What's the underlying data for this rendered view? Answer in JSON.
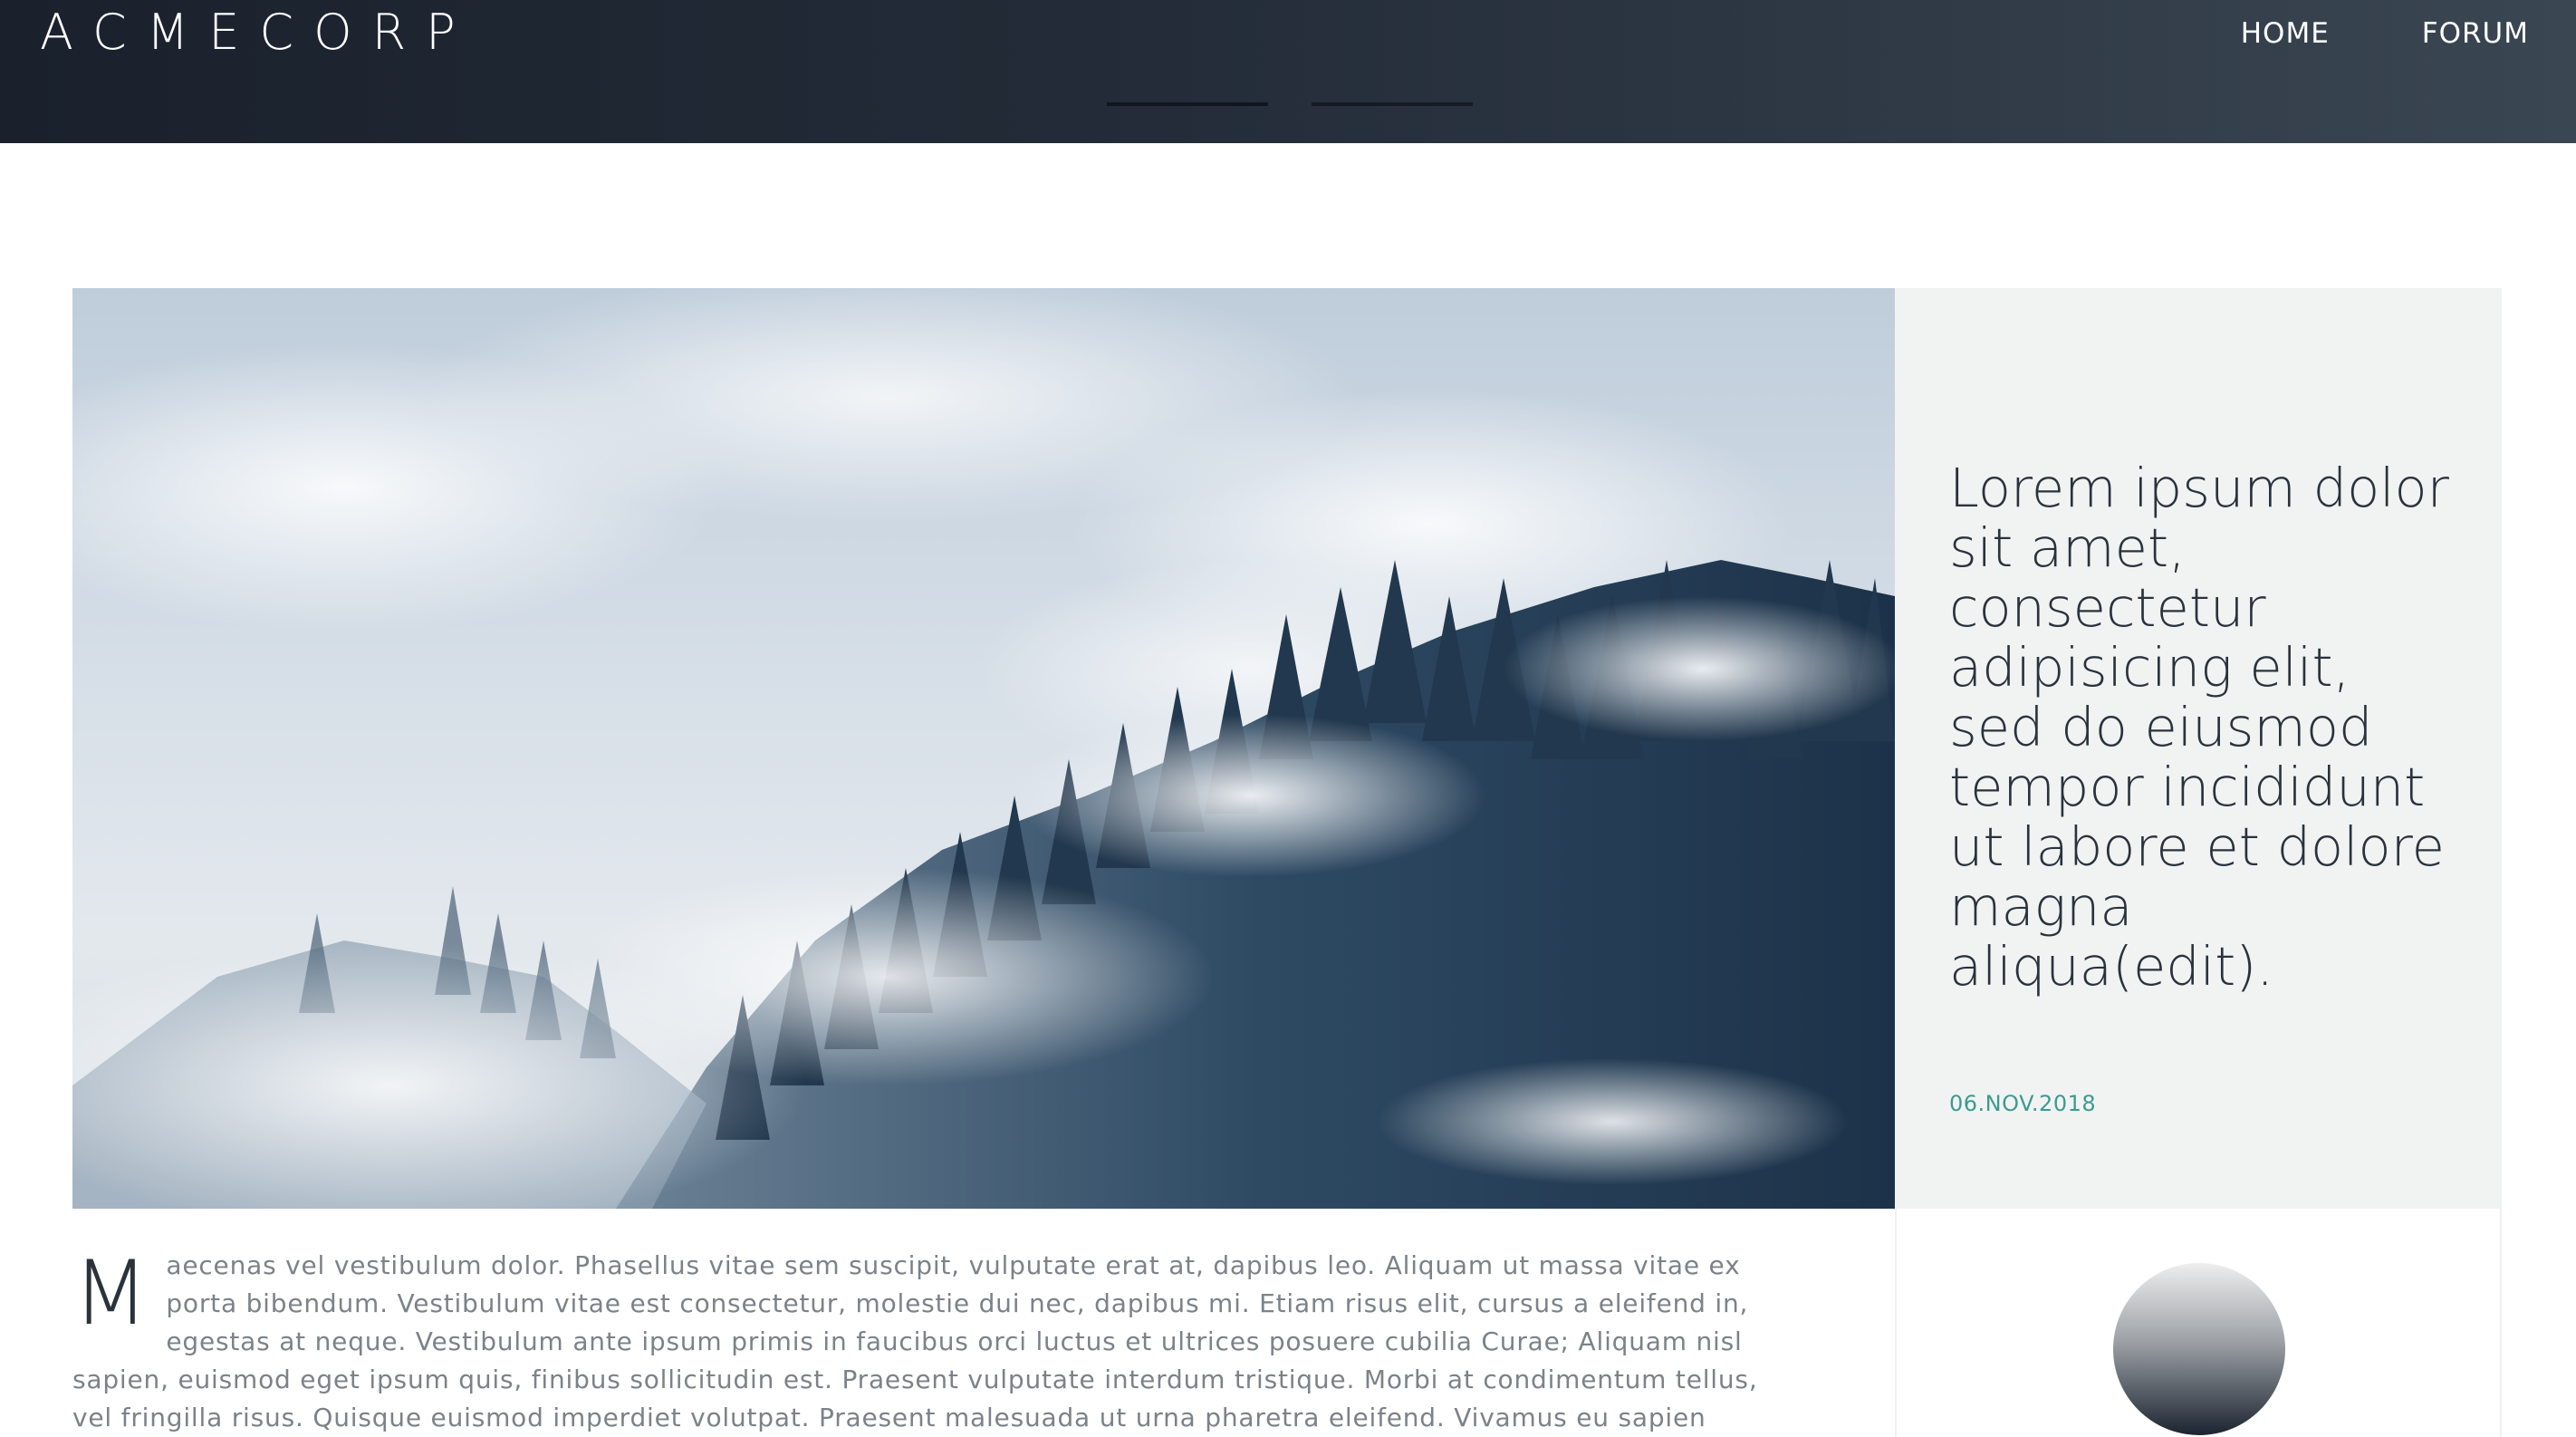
{
  "header": {
    "logo": "ACMECORP",
    "nav": [
      {
        "label": "HOME"
      },
      {
        "label": "FORUM"
      }
    ]
  },
  "slider": {
    "indicator_count": 2
  },
  "featured": {
    "image": "misty-pine-forest",
    "headline": "Lorem ipsum dolor sit amet, consectetur adipisicing elit, sed do eiusmod tempor incididunt ut labore et dolore magna aliqua(edit).",
    "date": "06.NOV.2018"
  },
  "article": {
    "dropcap": "M",
    "body": "aecenas vel vestibulum dolor. Phasellus vitae sem suscipit, vulputate erat at, dapibus leo. Aliquam ut massa vitae ex porta bibendum. Vestibulum vitae est consectetur, molestie dui nec, dapibus mi. Etiam risus elit, cursus a eleifend in, egestas at neque. Vestibulum ante ipsum primis in faucibus orci luctus et ultrices posuere cubilia Curae; Aliquam nisl sapien, euismod eget ipsum quis, finibus sollicitudin est. Praesent vulputate interdum tristique. Morbi at condimentum tellus, vel fringilla risus. Quisque euismod imperdiet volutpat. Praesent malesuada ut urna pharetra eleifend. Vivamus eu sapien lacus. Maecenas eu ligula"
  },
  "colors": {
    "header_start": "#1a212d",
    "header_end": "#3a4652",
    "accent_date": "#3d9a8f",
    "side_panel": "#f1f3f3",
    "headline_text": "#2a323c",
    "body_text": "#7c8289"
  }
}
